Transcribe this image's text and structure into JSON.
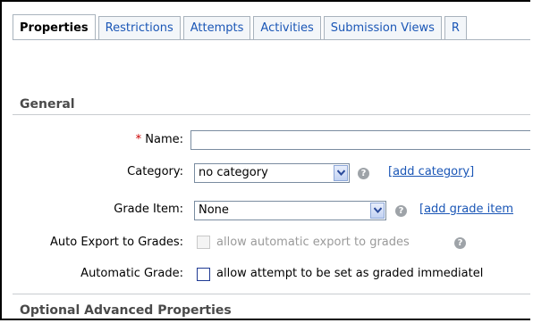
{
  "tabs": [
    {
      "label": "Properties",
      "active": true
    },
    {
      "label": "Restrictions"
    },
    {
      "label": "Attempts"
    },
    {
      "label": "Activities"
    },
    {
      "label": "Submission Views"
    },
    {
      "label": "R"
    }
  ],
  "general": {
    "section_title": "General",
    "name": {
      "required_marker": "*",
      "label": "Name:",
      "value": ""
    },
    "category": {
      "label": "Category:",
      "selected": "no category",
      "add_link": "[add category]"
    },
    "grade_item": {
      "label": "Grade Item:",
      "selected": "None",
      "add_link": "[add grade item"
    },
    "auto_export": {
      "label": "Auto Export to Grades:",
      "checkbox_text": "allow automatic export to grades",
      "checked": false,
      "disabled": true
    },
    "automatic_grade": {
      "label": "Automatic Grade:",
      "checkbox_text": "allow attempt to be set as graded immediatel",
      "checked": false
    }
  },
  "optional": {
    "section_title": "Optional Advanced Properties"
  },
  "icons": {
    "help": "help-icon",
    "dropdown": "chevron-down-icon"
  },
  "colors": {
    "link": "#1a56b6",
    "required": "#cc0000"
  }
}
